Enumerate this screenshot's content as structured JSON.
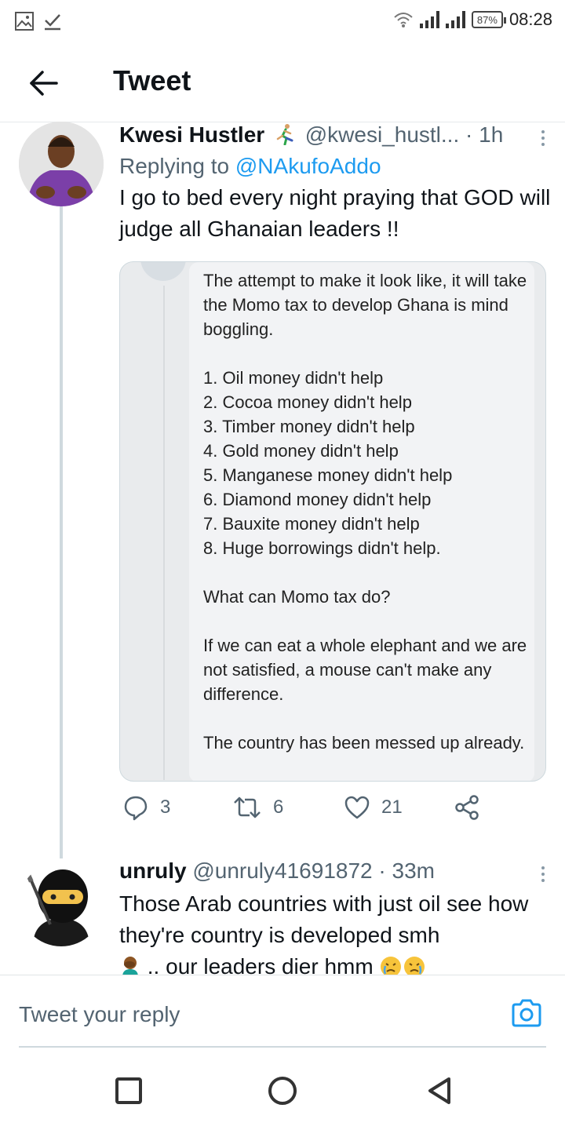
{
  "status_bar": {
    "battery": "87%",
    "time": "08:28"
  },
  "header": {
    "title": "Tweet"
  },
  "tweet1": {
    "name": "Kwesi Hustler",
    "handle": "@kwesi_hustl...",
    "time": "· 1h",
    "replying_prefix": "Replying to",
    "replying_to": "@NAkufoAddo",
    "text": "I go to bed every night praying that GOD will judge all Ghanaian leaders !!",
    "image_text": {
      "intro": "The attempt to make it look like, it will take the Momo tax to develop Ghana is mind boggling.",
      "list": [
        "1. Oil money didn't help",
        "2. Cocoa money didn't help",
        "3. Timber money didn't help",
        "4. Gold money didn't help",
        "5. Manganese money didn't help",
        "6. Diamond money didn't help",
        "7. Bauxite money didn't help",
        "8. Huge borrowings didn't help."
      ],
      "question": "What can Momo tax do?",
      "elephant": "If we can eat a whole elephant and we are not satisfied, a mouse can't make any difference.",
      "closing": "The country has been messed up already."
    },
    "reply_count": "3",
    "retweet_count": "6",
    "like_count": "21"
  },
  "tweet2": {
    "name": "unruly",
    "handle": "@unruly41691872",
    "time": "· 33m",
    "text": "Those Arab countries with just oil see how they're country is developed smh",
    "text_cont": ".. our leaders dier hmm"
  },
  "reply_bar": {
    "placeholder": "Tweet your reply"
  },
  "colors": {
    "accent": "#1d9bf0",
    "secondary_text": "#536471",
    "thread_line": "#cfd9de"
  }
}
